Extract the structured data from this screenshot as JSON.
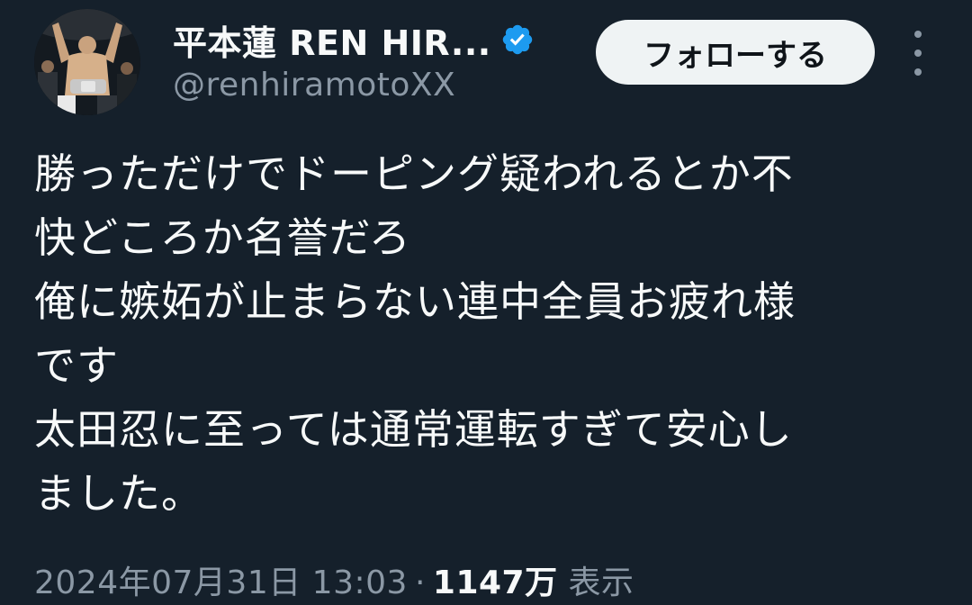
{
  "header": {
    "display_name": "平本蓮 REN HIR...",
    "handle": "@renhiramotoXX",
    "verified_icon": "verified-badge-icon",
    "follow_label": "フォローする",
    "more_icon": "more-vertical-icon"
  },
  "tweet": {
    "lines": [
      "勝っただけでドーピング疑われるとか不",
      "快どころか名誉だろ",
      "俺に嫉妬が止まらない連中全員お疲れ様",
      "です",
      "太田忍に至っては通常運転すぎて安心し",
      "ました。"
    ]
  },
  "meta": {
    "timestamp": "2024年07月31日 13:03",
    "separator": "·",
    "views_count": "1147万",
    "views_label": "表示"
  },
  "colors": {
    "background": "#15202b",
    "text_primary": "#f7f9f9",
    "text_secondary": "#8b98a5",
    "verified": "#1d9bf0",
    "follow_bg": "#eff3f4"
  }
}
